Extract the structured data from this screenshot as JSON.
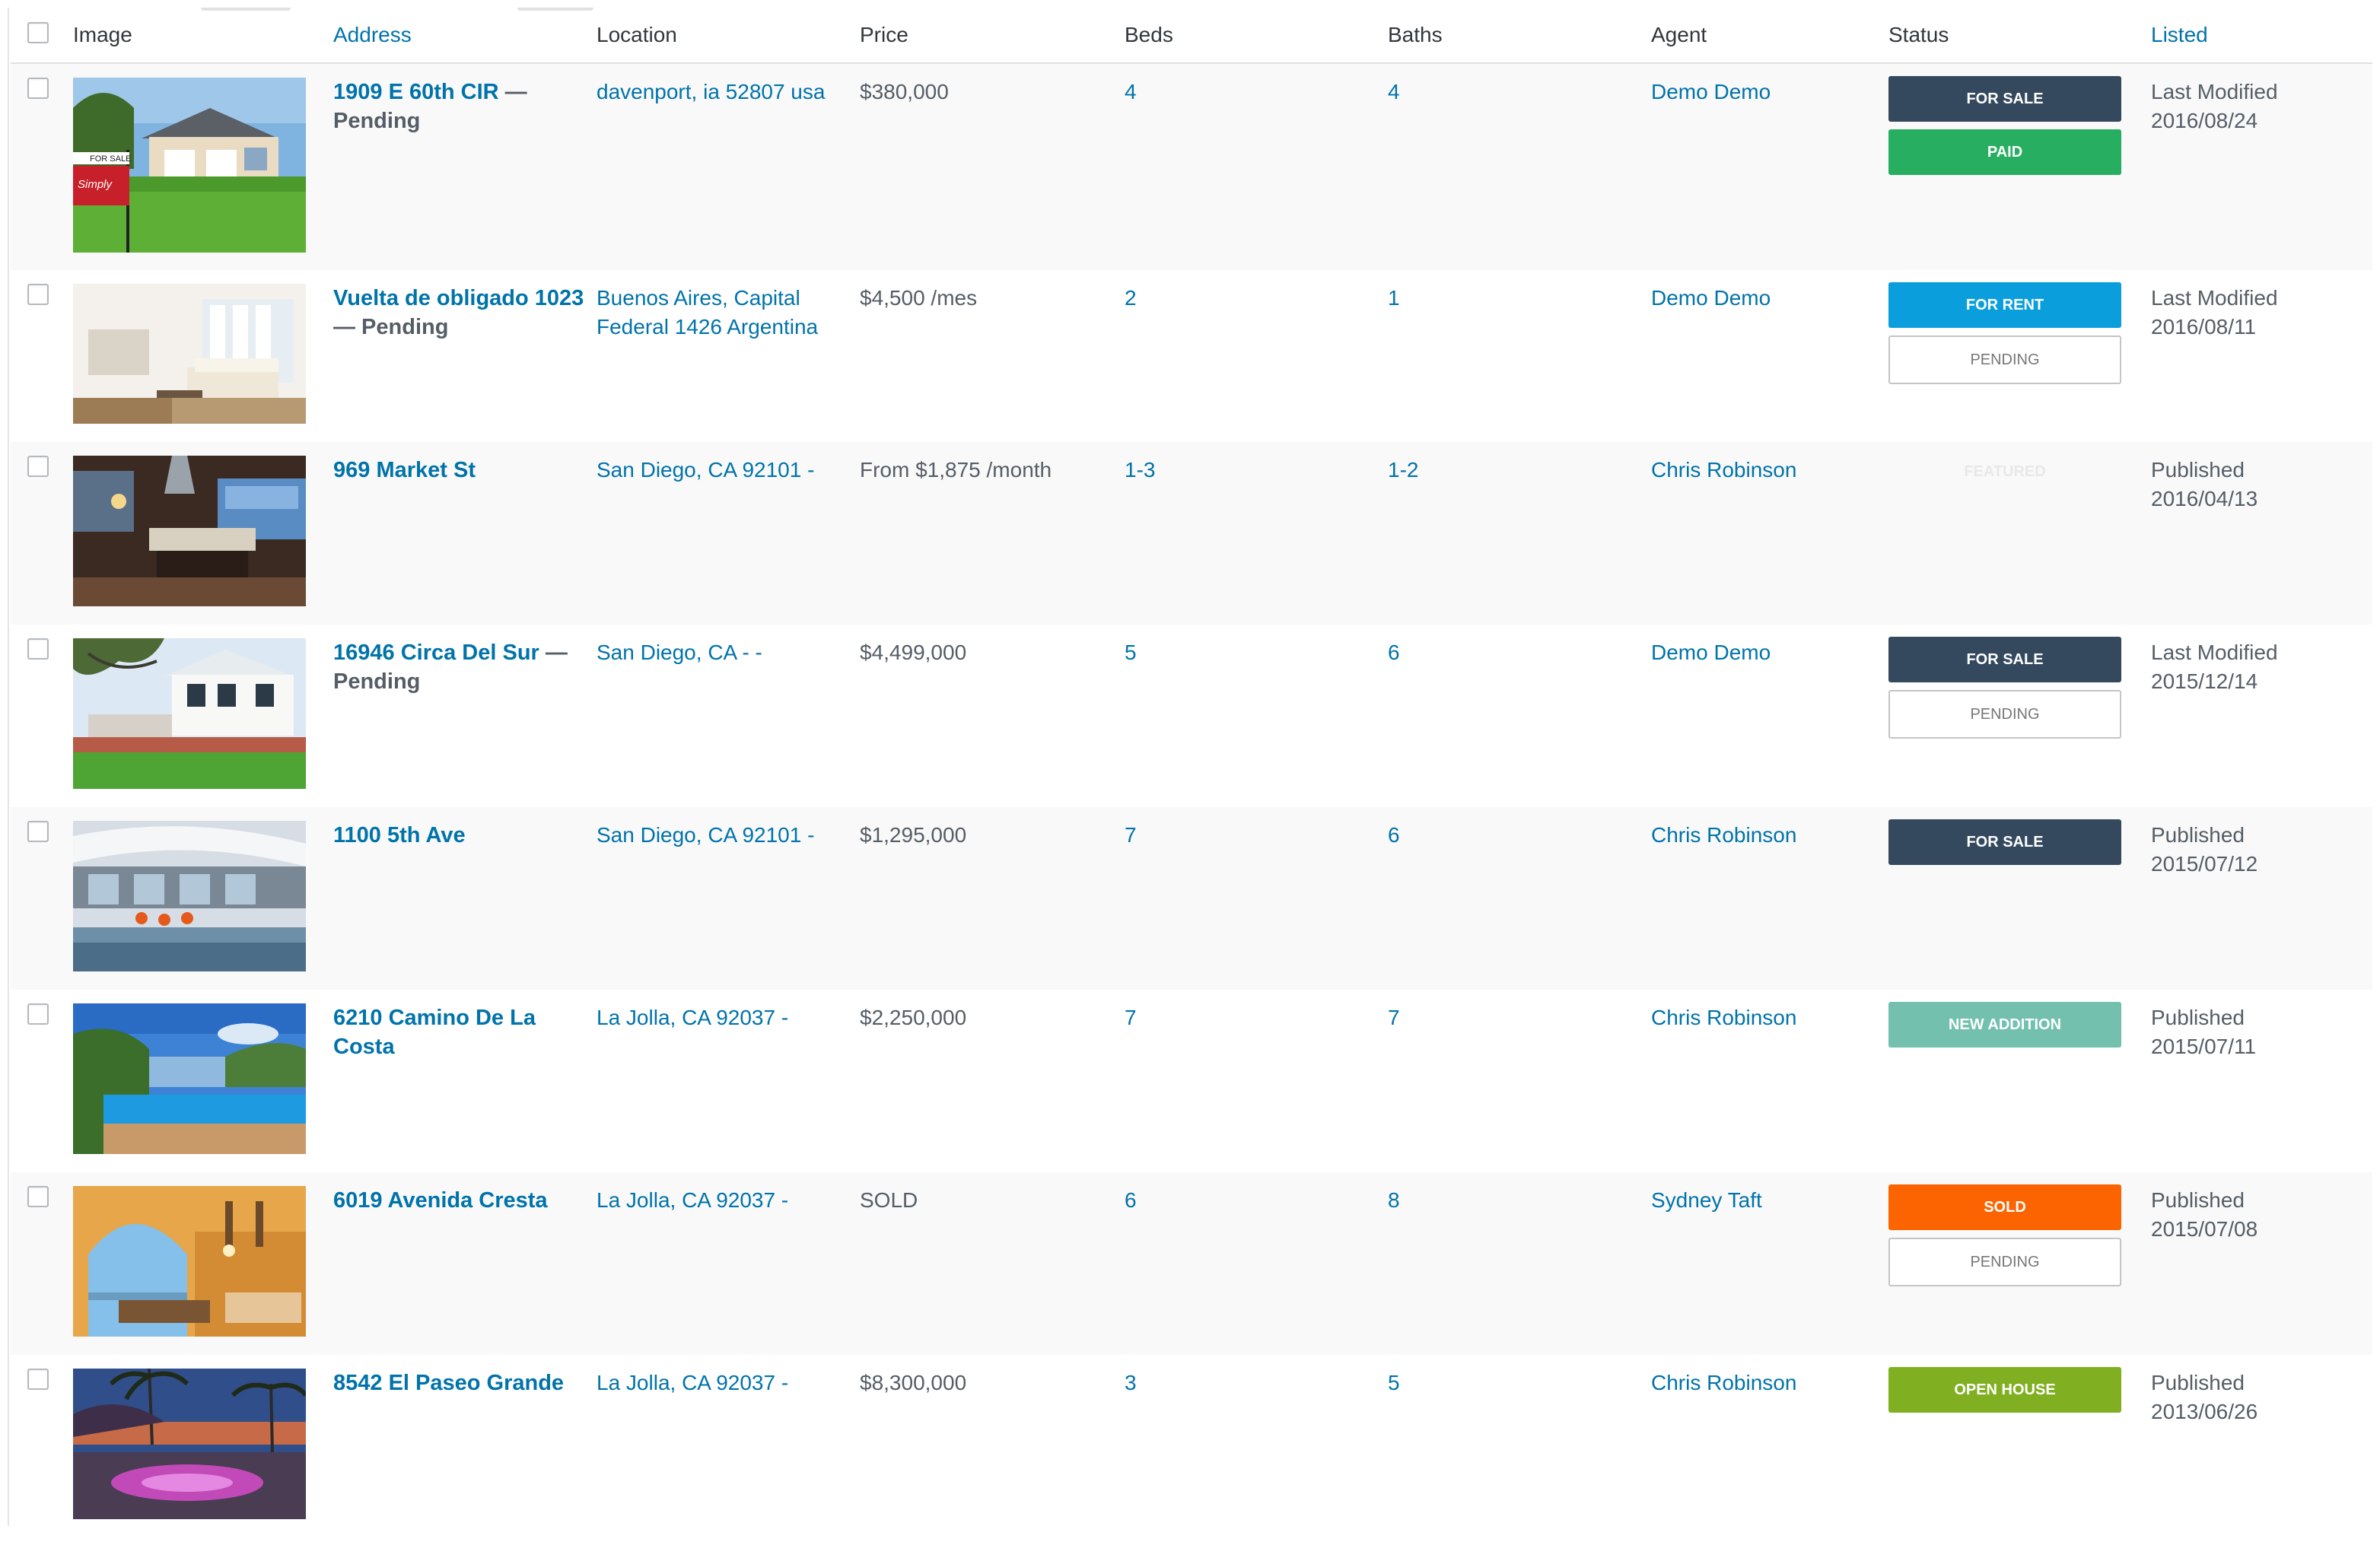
{
  "columns": {
    "image": "Image",
    "address": "Address",
    "location": "Location",
    "price": "Price",
    "beds": "Beds",
    "baths": "Baths",
    "agent": "Agent",
    "status": "Status",
    "listed": "Listed"
  },
  "colors": {
    "for_sale": "#34495e",
    "paid": "#27ae60",
    "for_rent": "#0a9fdc",
    "new_addition": "#72c0ad",
    "sold": "#fb6400",
    "open_house": "#80b022",
    "link": "#0073aa"
  },
  "rows": [
    {
      "address": "1909 E 60th CIR",
      "suffix": " — Pending",
      "location": "davenport, ia 52807 usa",
      "price": "$380,000",
      "beds": "4",
      "baths": "4",
      "agent": "Demo Demo",
      "badges": [
        {
          "label": "FOR SALE",
          "kind": "for_sale"
        },
        {
          "label": "PAID",
          "kind": "paid"
        }
      ],
      "listed_label": "Last Modified",
      "listed_date": "2016/08/24",
      "image": "house-lawn-for-sale-sign"
    },
    {
      "address": "Vuelta de obligado 1023",
      "suffix": " — Pending",
      "location": "Buenos Aires, Capital Federal 1426 Argentina",
      "price": "$4,500 /mes",
      "beds": "2",
      "baths": "1",
      "agent": "Demo Demo",
      "badges": [
        {
          "label": "FOR RENT",
          "kind": "for_rent"
        },
        {
          "label": "PENDING",
          "kind": "outline"
        }
      ],
      "listed_label": "Last Modified",
      "listed_date": "2016/08/11",
      "image": "bright-living-room"
    },
    {
      "address": "969 Market St",
      "suffix": "",
      "location": "San Diego, CA 92101 -",
      "price": "From $1,875 /month",
      "beds": "1-3",
      "baths": "1-2",
      "agent": "Chris Robinson",
      "badges": [],
      "faded_badge": "FEATURED",
      "listed_label": "Published",
      "listed_date": "2016/04/13",
      "image": "dark-kitchen"
    },
    {
      "address": "16946 Circa Del Sur",
      "suffix": " — Pending",
      "location": "San Diego, CA - -",
      "price": "$4,499,000",
      "beds": "5",
      "baths": "6",
      "agent": "Demo Demo",
      "badges": [
        {
          "label": "FOR SALE",
          "kind": "for_sale"
        },
        {
          "label": "PENDING",
          "kind": "outline"
        }
      ],
      "listed_label": "Last Modified",
      "listed_date": "2015/12/14",
      "image": "white-house-patio"
    },
    {
      "address": "1100 5th Ave",
      "suffix": "",
      "location": "San Diego, CA 92101 -",
      "price": "$1,295,000",
      "beds": "7",
      "baths": "6",
      "agent": "Chris Robinson",
      "badges": [
        {
          "label": "FOR SALE",
          "kind": "for_sale"
        }
      ],
      "listed_label": "Published",
      "listed_date": "2015/07/12",
      "image": "modern-pool-house"
    },
    {
      "address": "6210 Camino De La Costa",
      "suffix": "",
      "location": "La Jolla, CA 92037 -",
      "price": "$2,250,000",
      "beds": "7",
      "baths": "7",
      "agent": "Chris Robinson",
      "badges": [
        {
          "label": "NEW ADDITION",
          "kind": "new_addition"
        }
      ],
      "listed_label": "Published",
      "listed_date": "2015/07/11",
      "image": "infinity-pool-view"
    },
    {
      "address": "6019 Avenida Cresta",
      "suffix": "",
      "location": "La Jolla, CA 92037 -",
      "price": "SOLD",
      "beds": "6",
      "baths": "8",
      "agent": "Sydney Taft",
      "badges": [
        {
          "label": "SOLD",
          "kind": "sold"
        },
        {
          "label": "PENDING",
          "kind": "outline"
        }
      ],
      "listed_label": "Published",
      "listed_date": "2015/07/08",
      "image": "arched-terrace"
    },
    {
      "address": "8542 El Paseo Grande",
      "suffix": "",
      "location": "La Jolla, CA 92037 -",
      "price": "$8,300,000",
      "beds": "3",
      "baths": "5",
      "agent": "Chris Robinson",
      "badges": [
        {
          "label": "OPEN HOUSE",
          "kind": "open_house"
        }
      ],
      "listed_label": "Published",
      "listed_date": "2013/06/26",
      "image": "dusk-pool-palms"
    }
  ]
}
